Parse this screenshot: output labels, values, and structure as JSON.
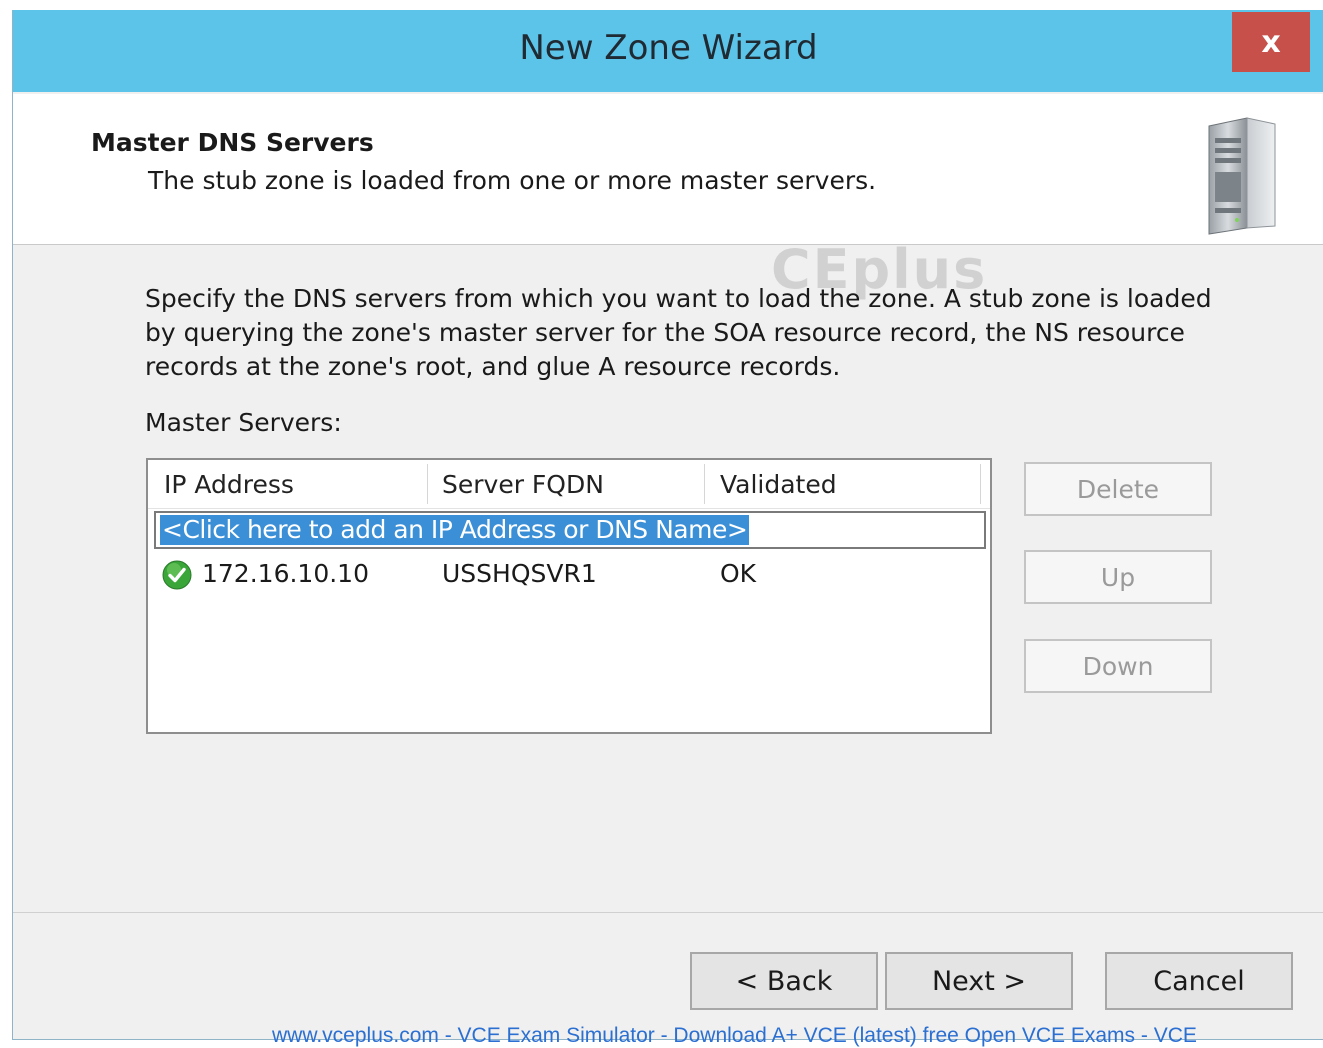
{
  "window": {
    "title": "New Zone Wizard",
    "close_label": "x"
  },
  "header": {
    "heading": "Master DNS Servers",
    "subheading": "The stub zone is loaded from one or more master servers."
  },
  "body": {
    "description": "Specify the DNS servers from which you want to load the zone. A stub zone is loaded by querying the zone's master server for the SOA resource record, the NS resource records at the zone's root, and glue A resource records.",
    "list_label": "Master Servers:"
  },
  "master_servers": {
    "columns": [
      "IP Address",
      "Server FQDN",
      "Validated"
    ],
    "add_placeholder": "<Click here to add an IP Address or DNS Name>",
    "rows": [
      {
        "ip": "172.16.10.10",
        "fqdn": "USSHQSVR1",
        "validated": "OK",
        "status_icon": "check-circle-icon"
      }
    ]
  },
  "side_buttons": {
    "delete": "Delete",
    "up": "Up",
    "down": "Down"
  },
  "nav_buttons": {
    "back": "< Back",
    "next": "Next >",
    "cancel": "Cancel"
  },
  "watermark": "CEplus",
  "footer_text": "www.vceplus.com - VCE Exam Simulator - Download A+ VCE (latest) free Open VCE Exams - VCE",
  "colors": {
    "titlebar": "#5cc4e9",
    "close_button": "#c7504a",
    "selection": "#3b8fd6",
    "ok_icon": "#3aa63a",
    "footer_link": "#2a6fd1"
  }
}
